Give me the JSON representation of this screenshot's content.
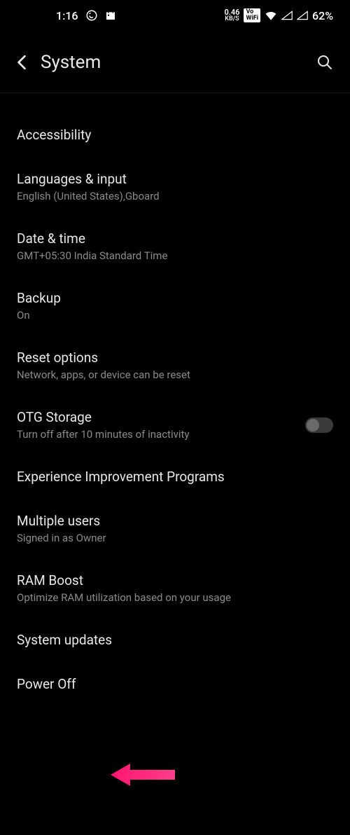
{
  "statusBar": {
    "time": "1:16",
    "kbsVal": "0.46",
    "kbsLabel": "KB/S",
    "volteLabel": "VoLTE WiFi",
    "battery": "62%"
  },
  "header": {
    "title": "System"
  },
  "settings": [
    {
      "title": "Accessibility",
      "subtitle": ""
    },
    {
      "title": "Languages & input",
      "subtitle": "English (United States),Gboard"
    },
    {
      "title": "Date & time",
      "subtitle": "GMT+05:30 India Standard Time"
    },
    {
      "title": "Backup",
      "subtitle": "On"
    },
    {
      "title": "Reset options",
      "subtitle": "Network, apps, or device can be reset"
    },
    {
      "title": "OTG Storage",
      "subtitle": "Turn off after 10 minutes of inactivity"
    },
    {
      "title": "Experience Improvement Programs",
      "subtitle": ""
    },
    {
      "title": "Multiple users",
      "subtitle": "Signed in as Owner"
    },
    {
      "title": "RAM Boost",
      "subtitle": "Optimize RAM utilization based on your usage"
    },
    {
      "title": "System updates",
      "subtitle": ""
    },
    {
      "title": "Power Off",
      "subtitle": ""
    }
  ],
  "annotation": {
    "color": "#ff1571"
  }
}
